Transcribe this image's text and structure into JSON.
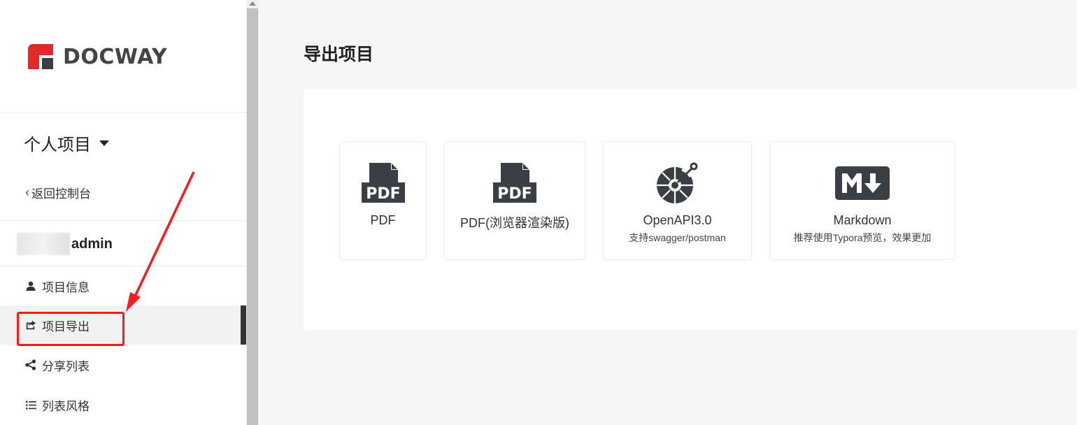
{
  "sidebar": {
    "logo_text": "DOCWAY",
    "project_switch": "个人项目",
    "back_link": "返回控制台",
    "project_name": "admin",
    "items": [
      {
        "label": "项目信息",
        "icon": "user-icon"
      },
      {
        "label": "项目导出",
        "icon": "share-out-icon",
        "active": true
      },
      {
        "label": "分享列表",
        "icon": "share-icon"
      },
      {
        "label": "列表风格",
        "icon": "list-icon"
      }
    ]
  },
  "main": {
    "title": "导出项目",
    "options": [
      {
        "label": "PDF",
        "sub": "",
        "icon": "pdf-icon"
      },
      {
        "label": "PDF(浏览器渲染版)",
        "sub": "",
        "icon": "pdf-icon"
      },
      {
        "label": "OpenAPI3.0",
        "sub": "支持swagger/postman",
        "icon": "openapi-icon"
      },
      {
        "label": "Markdown",
        "sub": "推荐使用Typora预览，效果更加",
        "icon": "markdown-icon"
      }
    ]
  },
  "colors": {
    "brand_red": "#e02b2b",
    "annotation_red": "#ff1a1a",
    "icon_dark": "#3a3f45",
    "page_bg": "#f5f6f8"
  }
}
